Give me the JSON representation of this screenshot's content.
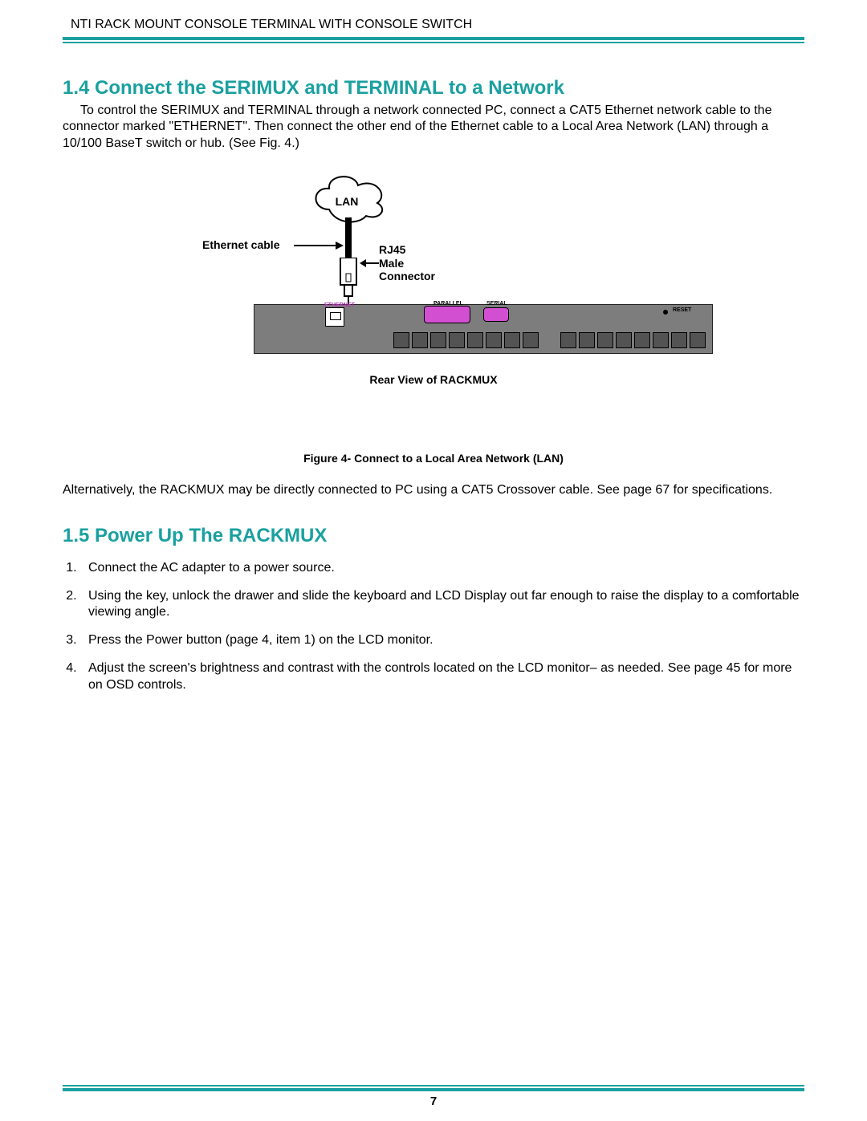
{
  "header": {
    "running_title": "NTI RACK MOUNT CONSOLE TERMINAL WITH CONSOLE SWITCH"
  },
  "section14": {
    "heading": "1.4  Connect the SERIMUX and TERMINAL to a Network",
    "body": "To control the SERIMUX and TERMINAL through a network connected PC, connect a CAT5 Ethernet network cable to the connector marked \"ETHERNET\". Then connect the other end of the Ethernet cable to a Local Area Network (LAN) through a 10/100 BaseT switch or hub. (See Fig. 4.)"
  },
  "figure": {
    "lan_label": "LAN",
    "ethernet_cable_label": "Ethernet cable",
    "rj45_label_line1": "RJ45",
    "rj45_label_line2": "Male",
    "rj45_label_line3": "Connector",
    "port_ethernet": "ETHERNET",
    "port_parallel": "PARALLEL",
    "port_serial": "SERIAL",
    "port_reset": "RESET",
    "rear_caption": "Rear View of RACKMUX",
    "fig_caption": "Figure 4- Connect to a Local Area Network (LAN)"
  },
  "section14_alt": "Alternatively,  the RACKMUX may be directly connected to PC using a CAT5 Crossover cable.   See page 67 for specifications.",
  "section15": {
    "heading": "1.5 Power Up The RACKMUX",
    "steps": [
      "Connect the AC adapter to a power source.",
      "Using the key, unlock the drawer and slide the keyboard and LCD Display out far enough to raise the display to a comfortable viewing angle.",
      "Press the Power button (page 4, item 1) on the LCD monitor.",
      "Adjust the screen's brightness and contrast with the controls located on the LCD monitor– as needed.   See page 45 for more on OSD controls."
    ]
  },
  "page_number": "7"
}
